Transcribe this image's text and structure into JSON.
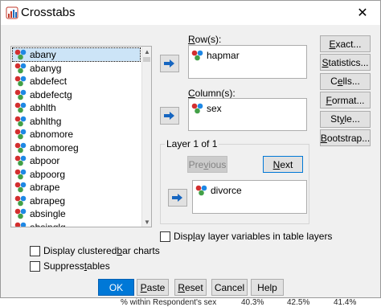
{
  "window": {
    "title": "Crosstabs",
    "close_glyph": "✕"
  },
  "variables": [
    "abany",
    "abanyg",
    "abdefect",
    "abdefectg",
    "abhlth",
    "abhlthg",
    "abnomore",
    "abnomoreg",
    "abpoor",
    "abpoorg",
    "abrape",
    "abrapeg",
    "absingle",
    "absinglg"
  ],
  "selected_variable": "abany",
  "rows": {
    "label_prefix": "",
    "label_underlined": "R",
    "label_rest": "ow(s):",
    "items": [
      "hapmar"
    ]
  },
  "columns": {
    "label_prefix": "",
    "label_underlined": "C",
    "label_rest": "olumn(s):",
    "items": [
      "sex"
    ]
  },
  "layer": {
    "title": "Layer 1 of 1",
    "previous_prefix": "Pre",
    "previous_underlined": "v",
    "previous_rest": "ious",
    "next_underlined": "N",
    "next_rest": "ext",
    "items": [
      "divorce"
    ]
  },
  "side_buttons": [
    {
      "pre": "",
      "u": "E",
      "post": "xact..."
    },
    {
      "pre": "",
      "u": "S",
      "post": "tatistics..."
    },
    {
      "pre": "C",
      "u": "e",
      "post": "lls..."
    },
    {
      "pre": "",
      "u": "F",
      "post": "ormat..."
    },
    {
      "pre": "St",
      "u": "y",
      "post": "le..."
    },
    {
      "pre": "",
      "u": "B",
      "post": "ootstrap..."
    }
  ],
  "options": {
    "display_layer_pre": "Disp",
    "display_layer_u": "l",
    "display_layer_post": "ay layer variables in table layers",
    "clustered_pre": "Display clustered ",
    "clustered_u": "b",
    "clustered_post": "ar charts",
    "suppress_pre": "Suppress ",
    "suppress_u": "t",
    "suppress_post": "ables"
  },
  "footer": {
    "ok": "OK",
    "paste_u": "P",
    "paste_post": "aste",
    "reset_u": "R",
    "reset_post": "eset",
    "cancel": "Cancel",
    "help": "Help"
  },
  "background_row": {
    "label": "% within Respondent's sex",
    "v1": "40.3%",
    "v2": "42.5%",
    "v3": "41.4%"
  },
  "colors": {
    "accent": "#0078d7",
    "selection": "#cce4f7"
  }
}
